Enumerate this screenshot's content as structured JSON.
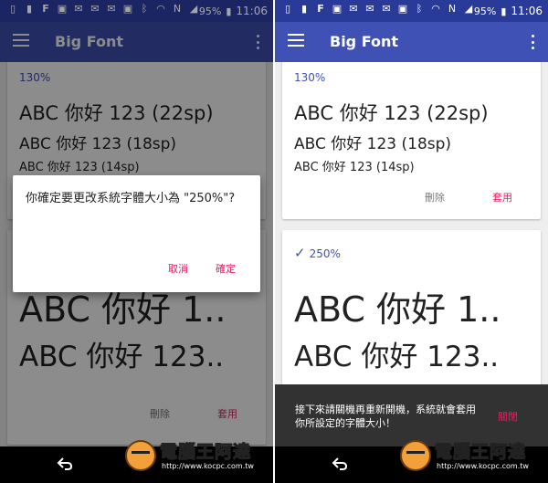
{
  "status_bar": {
    "left_icons": [
      "tablet-icon",
      "sim-icon",
      "facebook-icon",
      "image-icon",
      "mail-icon",
      "mail-icon",
      "mail-icon",
      "image-icon",
      "bluetooth-icon",
      "wifi-icon",
      "nfc-icon",
      "signal-icon"
    ],
    "battery": "95%",
    "time": "11:06"
  },
  "app": {
    "title": "Big Font"
  },
  "left_screen": {
    "card_1": {
      "label": "130%",
      "samples": [
        "ABC 你好 123 (22sp)",
        "ABC 你好 123 (18sp)",
        "ABC 你好 123 (14sp)"
      ]
    },
    "card_2": {
      "samples": [
        "ABC 你好 1..",
        "ABC 你好 123.."
      ],
      "delete_label": "刪除",
      "apply_label": "套用"
    },
    "dialog": {
      "message": "你確定要更改系統字體大小為 \"250%\"?",
      "cancel_label": "取消",
      "confirm_label": "確定"
    }
  },
  "right_screen": {
    "card_1": {
      "label": "130%",
      "samples": [
        "ABC 你好 123 (22sp)",
        "ABC 你好 123 (18sp)",
        "ABC 你好 123 (14sp)"
      ],
      "delete_label": "刪除",
      "apply_label": "套用"
    },
    "card_2": {
      "label": "250%",
      "samples": [
        "ABC 你好 1..",
        "ABC 你好 123.."
      ]
    },
    "snackbar": {
      "message": "接下來請關機再重新開機，系統就會套用你所設定的字體大小！",
      "action_label": "關閉"
    }
  },
  "watermark": {
    "text": "電腦王阿達",
    "url": "http://www.kocpc.com.tw"
  },
  "colors": {
    "status_bar": "#2a3a99",
    "app_bar": "#3f51b5",
    "accent": "#e91e63",
    "label": "#3f51b5"
  }
}
